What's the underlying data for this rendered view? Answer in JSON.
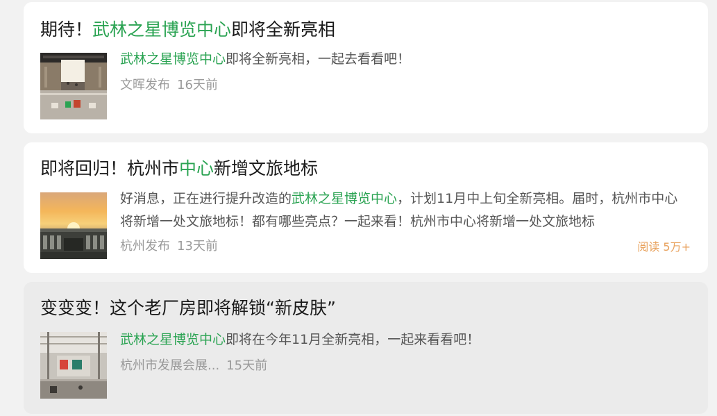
{
  "feed": [
    {
      "title_prefix": "期待！",
      "title_highlight": "武林之星博览中心",
      "title_suffix": "即将全新亮相",
      "summary_highlight": "武林之星博览中心",
      "summary_rest": "即将全新亮相，一起去看看吧！",
      "source": "文晖发布",
      "time": "16天前"
    },
    {
      "title_prefix": "即将回归！杭州市",
      "title_highlight": "中心",
      "title_suffix": "新增文旅地标",
      "summary_prefix": "好消息，正在进行提升改造的",
      "summary_highlight": "武林之星博览中心",
      "summary_rest": "，计划11月中上旬全新亮相。届时，杭州市中心将新增一处文旅地标！都有哪些亮点？一起来看！杭州市中心将新增一处文旅地标",
      "source": "杭州发布",
      "time": "13天前",
      "reads": "阅读 5万+"
    },
    {
      "title": "变变变！这个老厂房即将解锁“新皮肤”",
      "summary_highlight": "武林之星博览中心",
      "summary_rest": "即将在今年11月全新亮相，一起来看看吧！",
      "source": "杭州市发展会展...",
      "time": "15天前"
    }
  ],
  "colors": {
    "highlight": "#2aa352",
    "reads": "#e8a15c",
    "meta": "#9a9a9a"
  }
}
